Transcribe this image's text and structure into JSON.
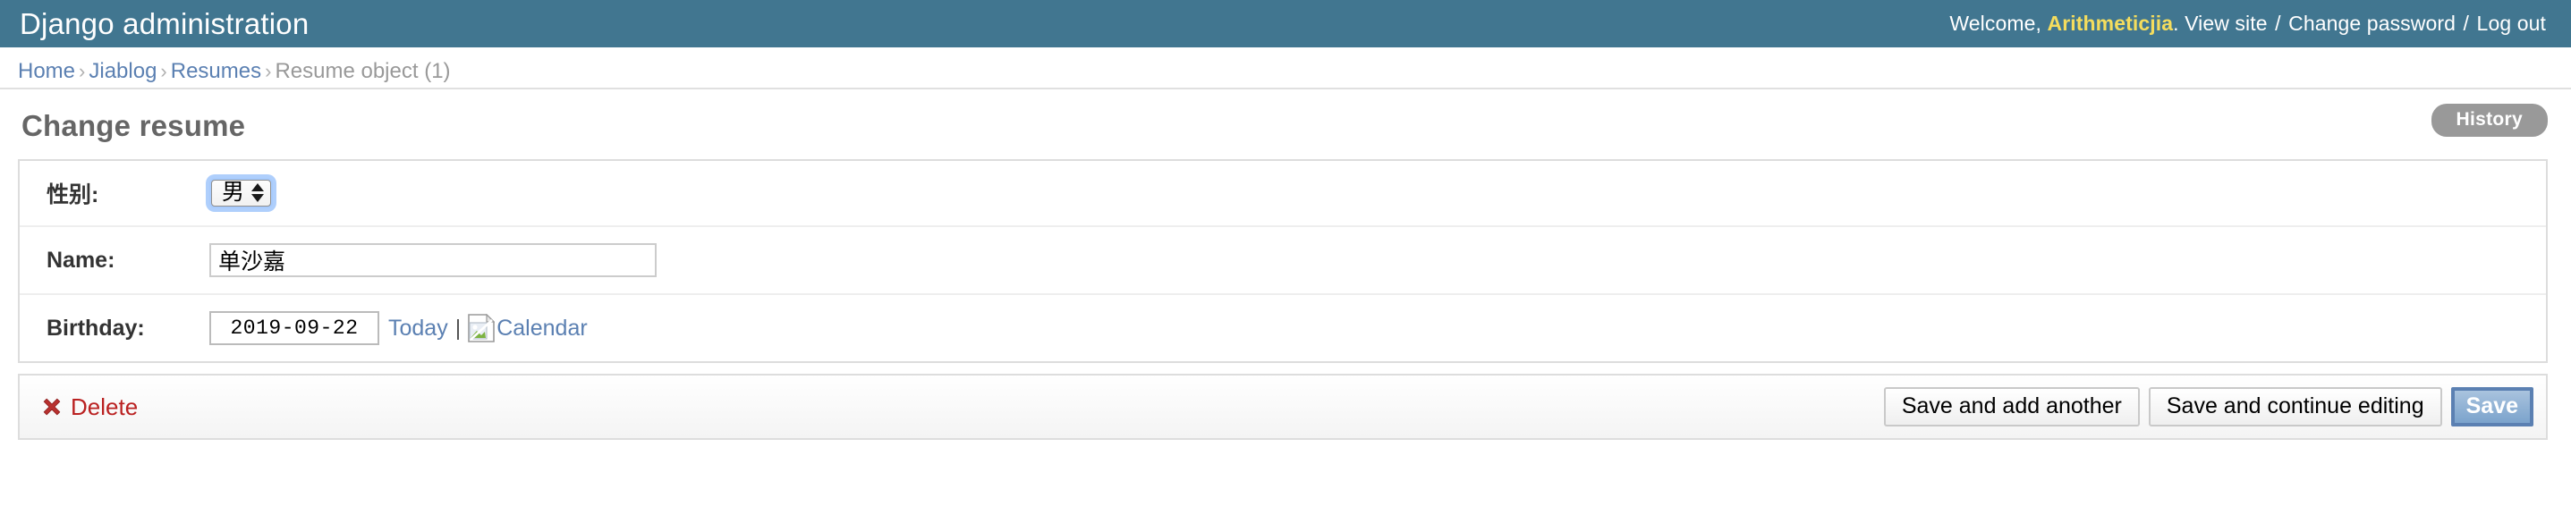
{
  "header": {
    "site_title": "Django administration",
    "welcome_prefix": "Welcome,",
    "username": "Arithmeticjia",
    "username_suffix": ".",
    "view_site": "View site",
    "change_password": "Change password",
    "log_out": "Log out",
    "separator": "/",
    "bg_color": "#417690",
    "accent_color": "#f5dd5d"
  },
  "breadcrumbs": {
    "items": [
      {
        "label": "Home",
        "is_link": true
      },
      {
        "label": "Jiablog",
        "is_link": true
      },
      {
        "label": "Resumes",
        "is_link": true
      },
      {
        "label": "Resume object (1)",
        "is_link": false
      }
    ],
    "separator": "›",
    "link_color": "#5b80b2",
    "current_color": "#999999"
  },
  "content": {
    "page_title": "Change resume",
    "object_tools": {
      "history_label": "History",
      "history_bg": "#999999"
    },
    "form": {
      "rows": [
        {
          "label": "性别:",
          "field_name": "gender-select",
          "widget": "select",
          "value": "男",
          "focused": true
        },
        {
          "label": "Name:",
          "field_name": "name-input",
          "widget": "text",
          "value": "单沙嘉",
          "focused": false
        },
        {
          "label": "Birthday:",
          "field_name": "birthday-input",
          "widget": "date",
          "value": "2019-09-22",
          "focused": false,
          "shortcuts": {
            "today_label": "Today",
            "pipe": "|",
            "calendar_label": "Calendar",
            "calendar_icon": "broken-image-icon"
          }
        }
      ]
    },
    "submit_row": {
      "delete_label": "Delete",
      "delete_icon": "delete-cross-icon",
      "delete_color": "#ba2121",
      "buttons": [
        {
          "label": "Save and add another",
          "name": "save-and-add-another-button",
          "default": false
        },
        {
          "label": "Save and continue editing",
          "name": "save-and-continue-editing-button",
          "default": false
        },
        {
          "label": "Save",
          "name": "save-button",
          "default": true
        }
      ],
      "default_button_color": "#7ba3cc"
    }
  }
}
